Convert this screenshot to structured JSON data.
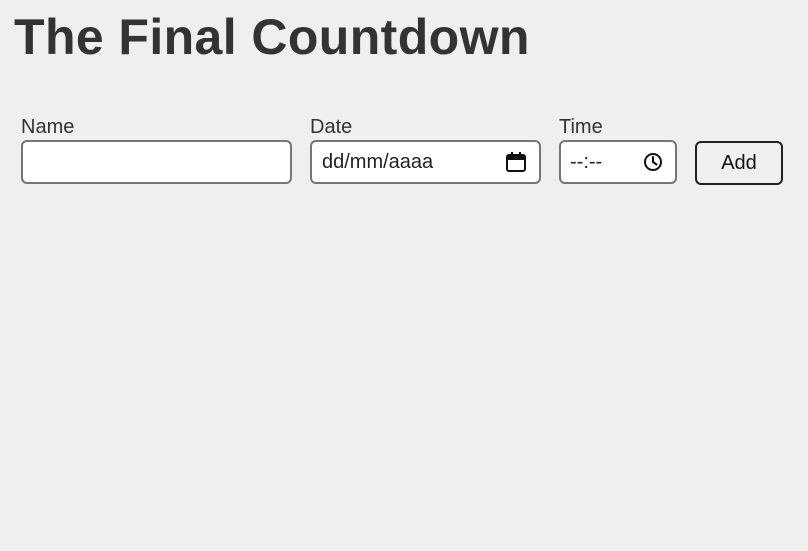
{
  "page": {
    "title": "The Final Countdown"
  },
  "form": {
    "name": {
      "label": "Name",
      "value": "",
      "placeholder": ""
    },
    "date": {
      "label": "Date",
      "placeholder": "dd/mm/aaaa",
      "icon": "calendar-icon"
    },
    "time": {
      "label": "Time",
      "placeholder": "--:--",
      "icon": "clock-icon"
    },
    "add_label": "Add"
  },
  "colors": {
    "background": "#efefef",
    "text": "#333333",
    "input_border": "#767676",
    "button_border": "#222222"
  }
}
